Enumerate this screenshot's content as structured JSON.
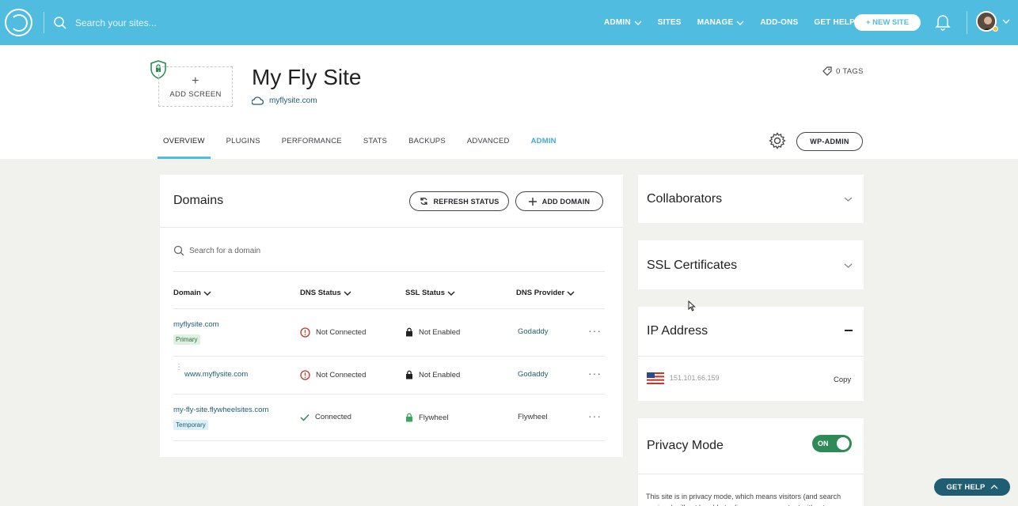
{
  "topbar": {
    "search_placeholder": "Search your sites...",
    "nav": [
      "ADMIN",
      "SITES",
      "MANAGE",
      "ADD-ONS",
      "GET HELP"
    ],
    "new_site": "+ NEW SITE",
    "accent": "#50bde0"
  },
  "site": {
    "add_screen": "ADD SCREEN",
    "title": "My Fly Site",
    "url": "myflysite.com",
    "tags": "0 TAGS"
  },
  "tabs": [
    "OVERVIEW",
    "PLUGINS",
    "PERFORMANCE",
    "STATS",
    "BACKUPS",
    "ADVANCED",
    "ADMIN"
  ],
  "wp_admin": "WP-ADMIN",
  "domains": {
    "title": "Domains",
    "refresh": "REFRESH STATUS",
    "add": "ADD DOMAIN",
    "search_placeholder": "Search for a domain",
    "columns": [
      "Domain",
      "DNS Status",
      "SSL Status",
      "DNS Provider"
    ],
    "rows": [
      {
        "domain": "myflysite.com",
        "badge": "Primary",
        "dns": "Not Connected",
        "ssl": "Not Enabled",
        "provider": "Godaddy"
      },
      {
        "domain": "www.myflysite.com",
        "badge": "",
        "dns": "Not Connected",
        "ssl": "Not Enabled",
        "provider": "Godaddy"
      },
      {
        "domain": "my-fly-site.flywheelsites.com",
        "badge": "Temporary",
        "dns": "Connected",
        "ssl": "Flywheel",
        "provider": "Flywheel"
      }
    ]
  },
  "sidebar": {
    "collaborators": "Collaborators",
    "ssl": "SSL Certificates",
    "ip_title": "IP Address",
    "ip": "151.101.66.159",
    "copy": "Copy",
    "privacy_title": "Privacy Mode",
    "privacy_toggle": "ON",
    "privacy_text": "This site is in privacy mode, which means visitors (and search engines) will not be able to discover your content without"
  },
  "get_help": "GET HELP"
}
